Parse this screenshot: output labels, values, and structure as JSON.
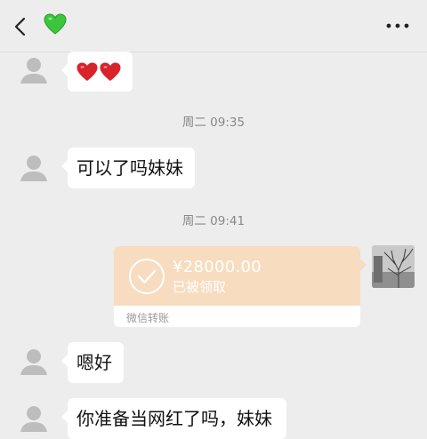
{
  "header": {
    "back_icon": "chevron-left-icon",
    "contact_icon": "green-heart-icon",
    "more_icon": "more-dots-icon"
  },
  "messages": [
    {
      "type": "emoji",
      "icons": [
        "red-heart-icon",
        "red-heart-icon"
      ]
    },
    {
      "type": "time",
      "text": "周二 09:35"
    },
    {
      "type": "text",
      "text": "可以了吗妹妹"
    },
    {
      "type": "time",
      "text": "周二 09:41"
    },
    {
      "type": "transfer",
      "amount": "¥28000.00",
      "status": "已被领取",
      "label": "微信转账"
    },
    {
      "type": "text",
      "text": "嗯好"
    },
    {
      "type": "text",
      "text": "你准备当网红了吗，妹妹"
    }
  ],
  "colors": {
    "background": "#ededed",
    "transfer": "#f7dcbf",
    "heart_green": "#3cc63c",
    "heart_red": "#d8232a"
  }
}
